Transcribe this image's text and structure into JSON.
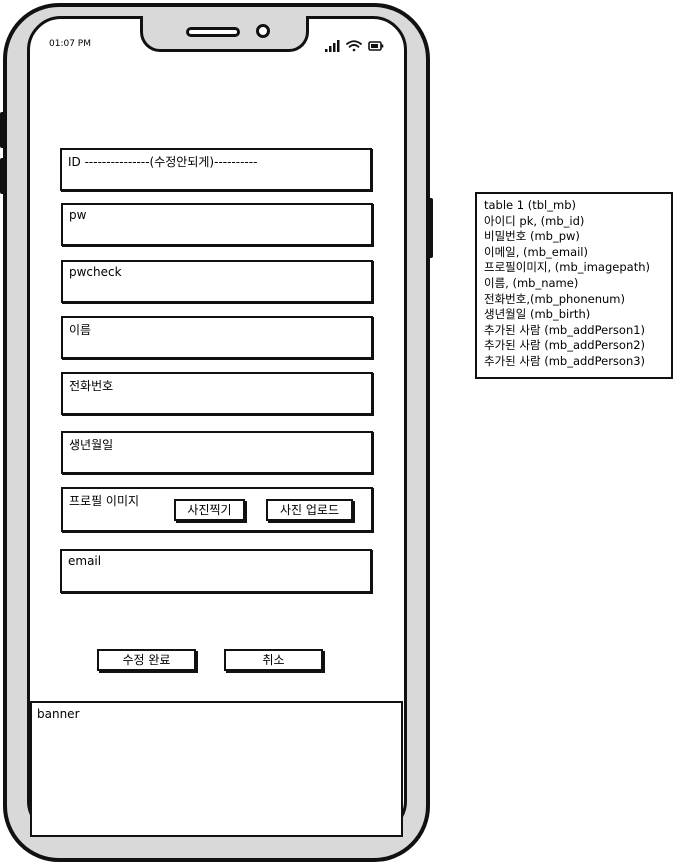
{
  "status_bar": {
    "time": "01:07 PM",
    "icons": [
      "signal-icon",
      "wifi-icon",
      "battery-icon"
    ]
  },
  "form": {
    "id_label": "ID ---------------(수정안되게)----------",
    "pw_label": "pw",
    "pwcheck_label": "pwcheck",
    "name_label": "이름",
    "phone_label": "전화번호",
    "birth_label": "생년월일",
    "profile_label": "프로필 이미지",
    "take_photo_button": "사진찍기",
    "upload_photo_button": "사진 업로드",
    "email_label": "email"
  },
  "actions": {
    "submit_label": "수정 완료",
    "cancel_label": "취소"
  },
  "banner": {
    "label": "banner"
  },
  "table_note": {
    "lines": [
      "table 1 (tbl_mb)",
      "아이디 pk, (mb_id)",
      "비밀번호 (mb_pw)",
      "이메일, (mb_email)",
      "프로필이미지, (mb_imagepath)",
      "이름, (mb_name)",
      "전화번호,(mb_phonenum)",
      "생년월일 (mb_birth)",
      "추가된 사람 (mb_addPerson1)",
      "추가된 사람 (mb_addPerson2)",
      "추가된 사람 (mb_addPerson3)"
    ]
  },
  "colors": {
    "outline": "#111111",
    "frame_fill": "#d9d9d9",
    "screen_fill": "#ffffff"
  }
}
